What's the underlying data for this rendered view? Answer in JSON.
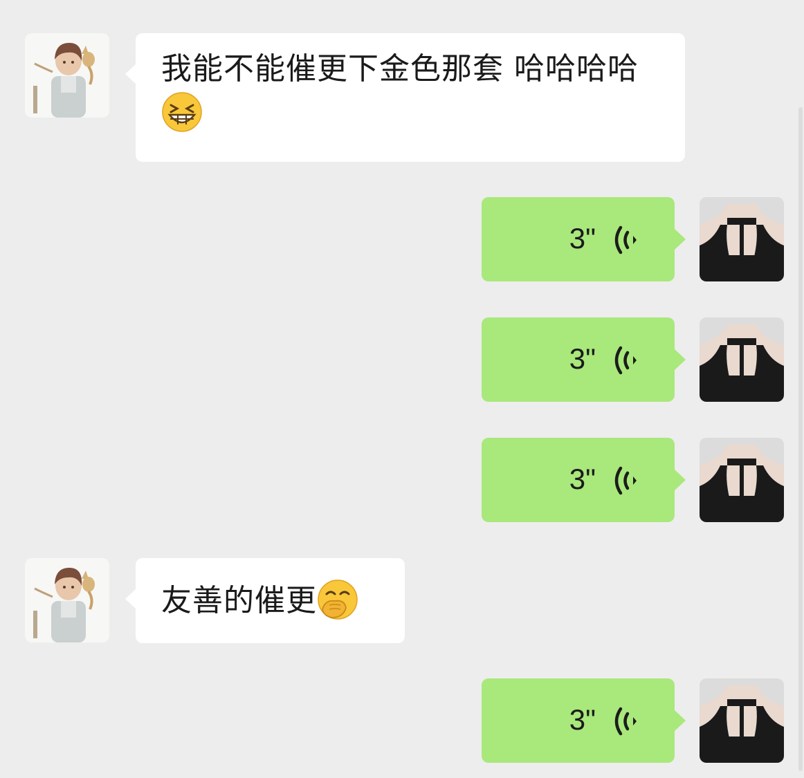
{
  "messages": [
    {
      "from": "friend",
      "text": "我能不能催更下金色那套 哈哈哈哈",
      "emoji": "grinning-squinting-face"
    },
    {
      "from": "me",
      "type": "voice",
      "duration": "3\""
    },
    {
      "from": "me",
      "type": "voice",
      "duration": "3\""
    },
    {
      "from": "me",
      "type": "voice",
      "duration": "3\""
    },
    {
      "from": "friend",
      "text": "友善的催更",
      "emoji": "face-with-hand-over-mouth"
    },
    {
      "from": "me",
      "type": "voice",
      "duration": "3\""
    }
  ],
  "colors": {
    "background": "#ededed",
    "incoming_bubble": "#ffffff",
    "outgoing_bubble": "#a9e87b"
  }
}
